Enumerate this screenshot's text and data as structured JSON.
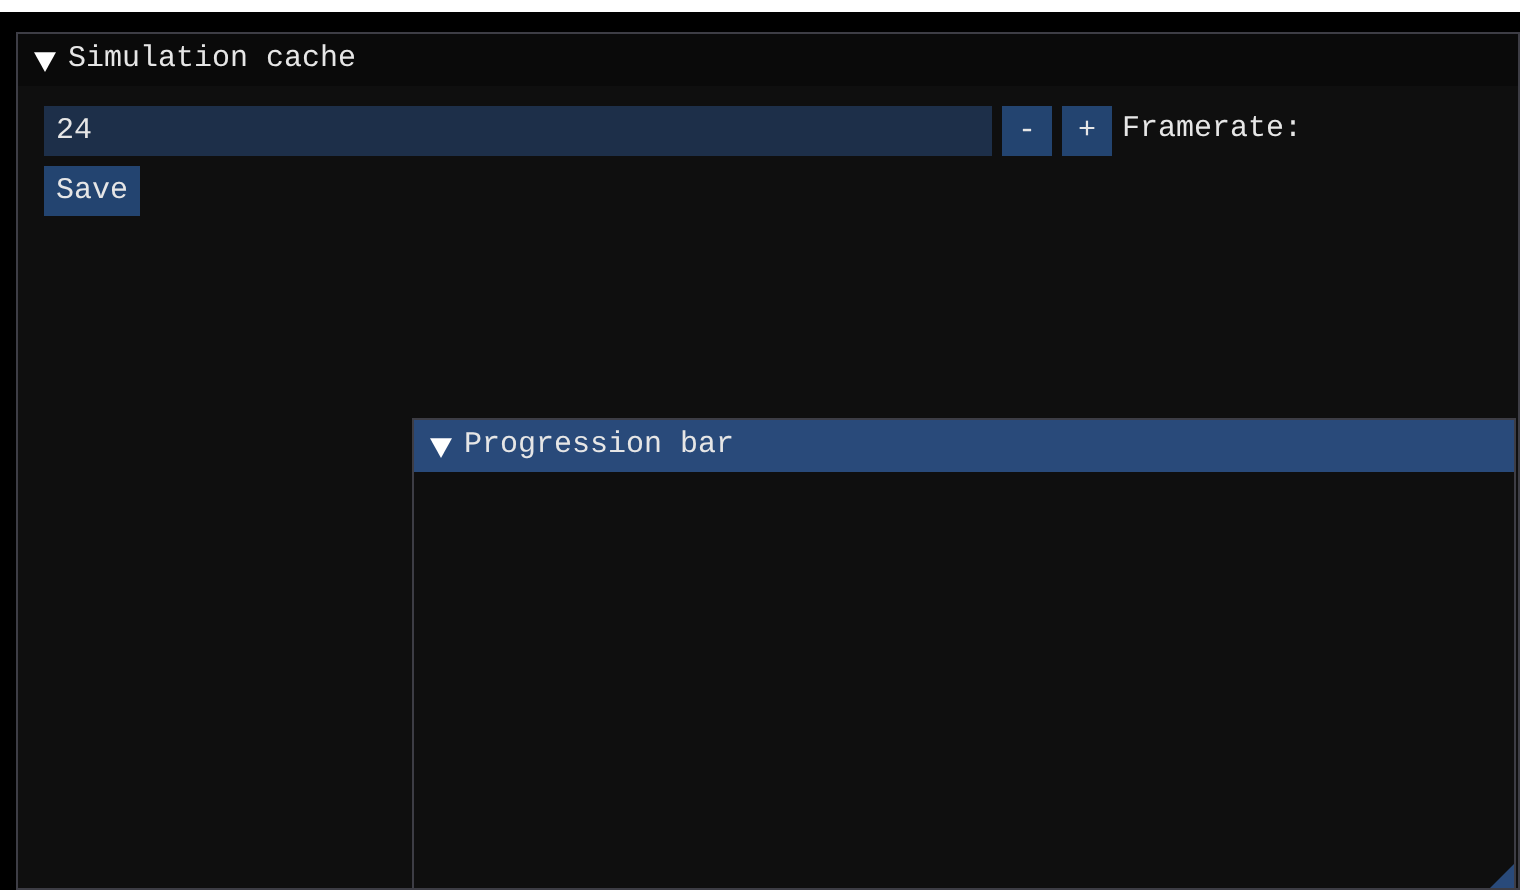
{
  "windows": [
    {
      "title": "Simulation cache",
      "expanded": true,
      "focused": false,
      "controls": [
        {
          "kind": "input_int",
          "label": "Framerate:",
          "value": "24",
          "step_buttons": [
            "-",
            "+"
          ]
        },
        {
          "kind": "button",
          "text": "Save"
        }
      ]
    },
    {
      "title": "Progression bar",
      "expanded": true,
      "focused": true,
      "resize_grip": true
    }
  ]
}
